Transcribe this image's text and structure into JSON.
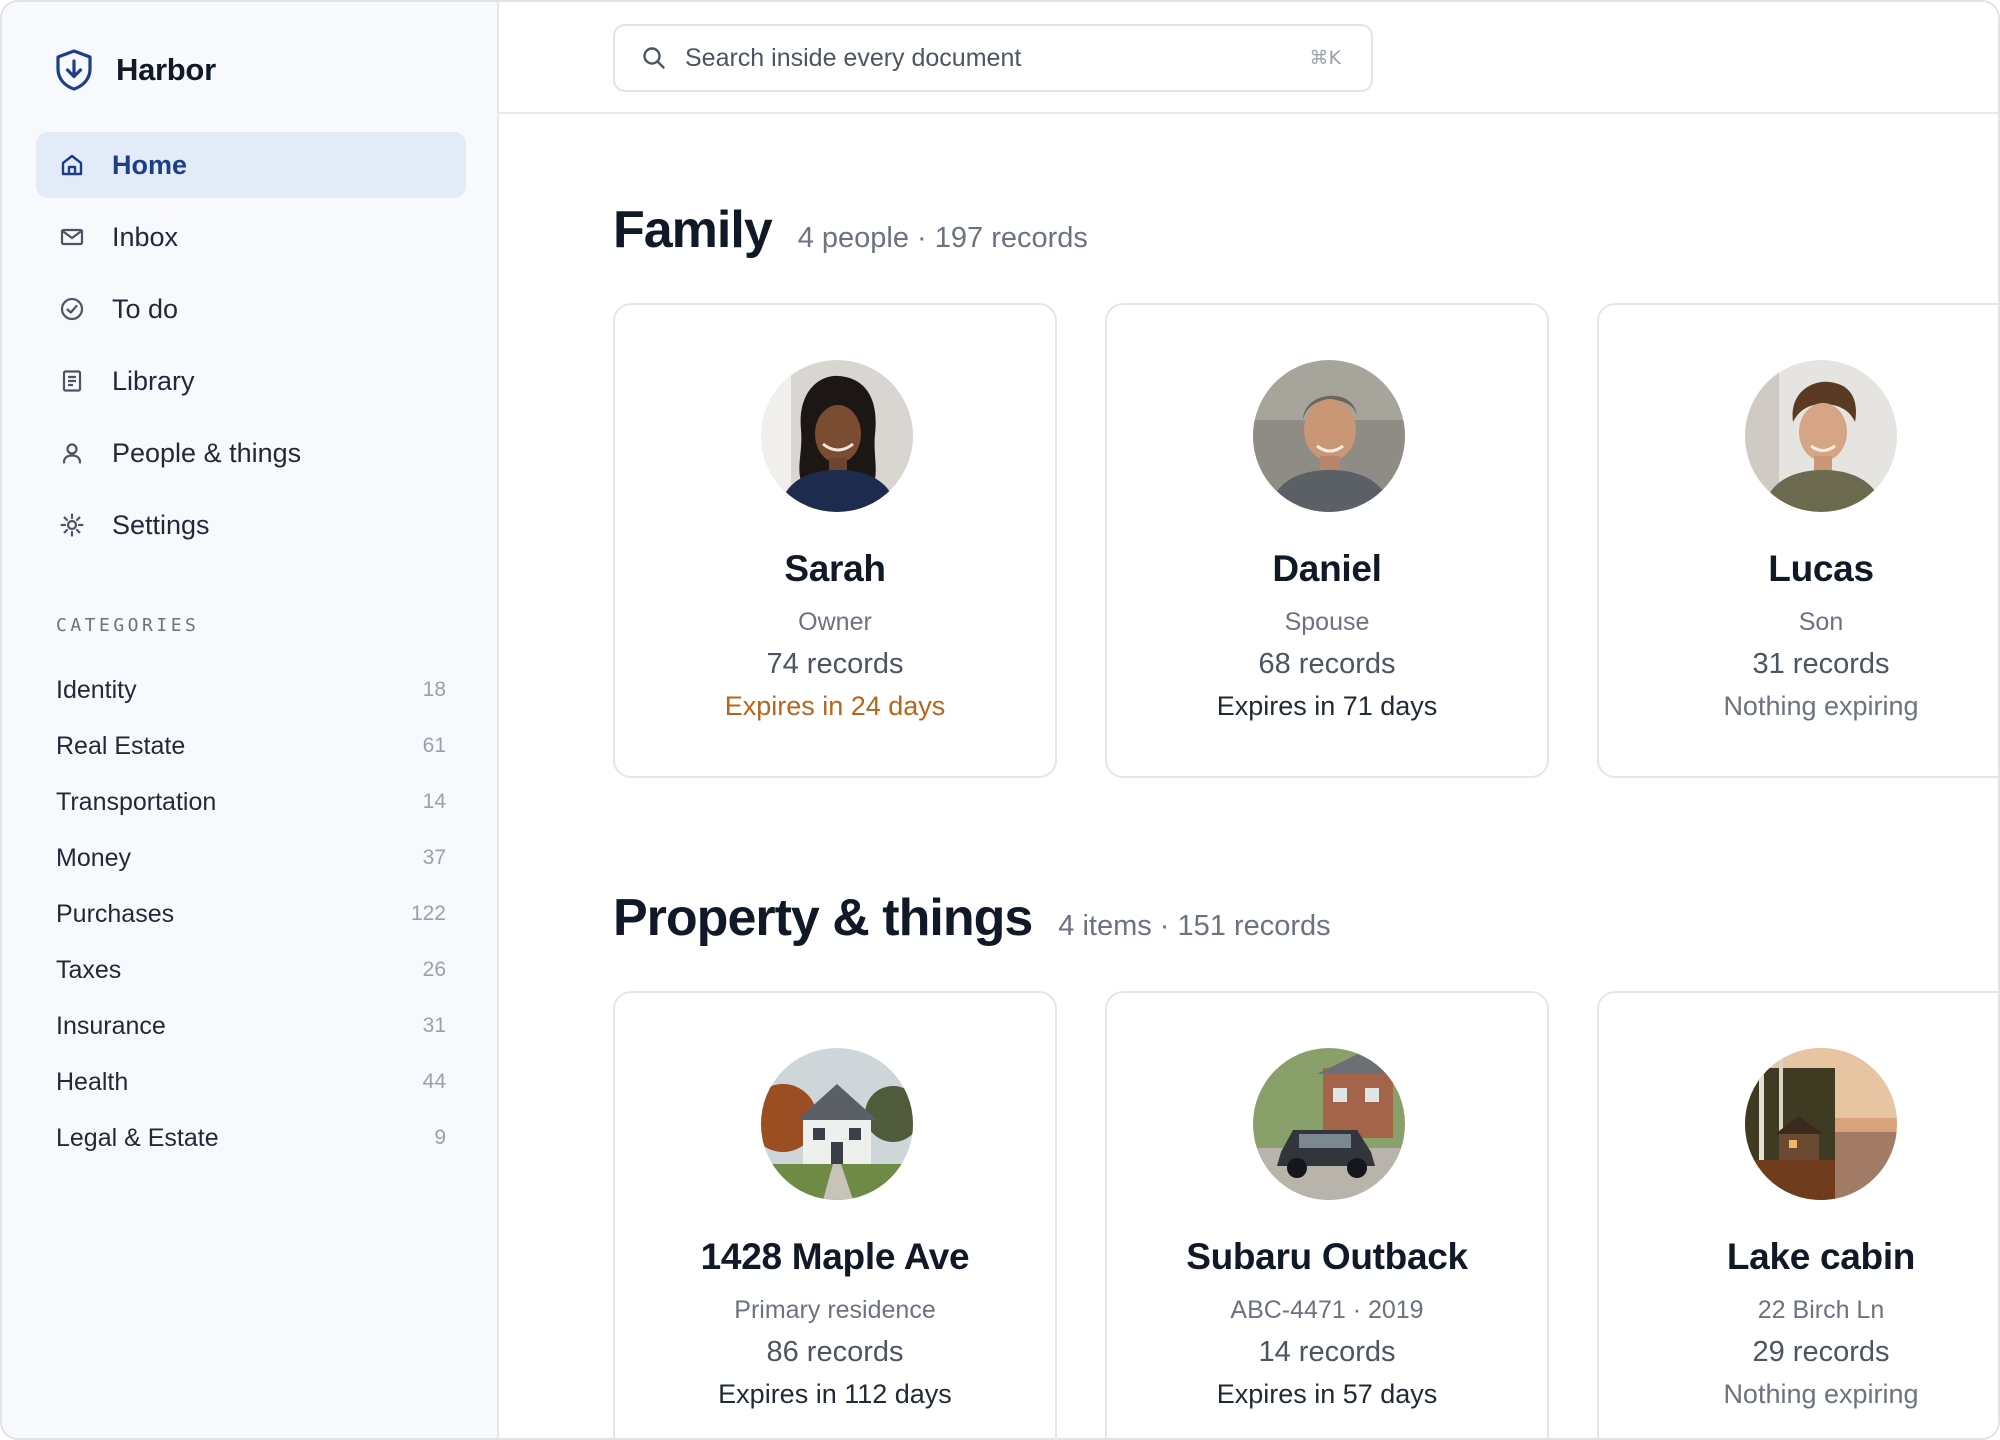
{
  "app": {
    "name": "Harbor"
  },
  "nav": [
    {
      "label": "Home",
      "icon": "home-icon",
      "active": true
    },
    {
      "label": "Inbox",
      "icon": "mail-icon"
    },
    {
      "label": "To do",
      "icon": "check-circle-icon"
    },
    {
      "label": "Library",
      "icon": "document-icon"
    },
    {
      "label": "People & things",
      "icon": "user-icon"
    },
    {
      "label": "Settings",
      "icon": "gear-icon"
    }
  ],
  "categories": {
    "heading": "CATEGORIES",
    "items": [
      {
        "label": "Identity",
        "count": "18"
      },
      {
        "label": "Real Estate",
        "count": "61"
      },
      {
        "label": "Transportation",
        "count": "14"
      },
      {
        "label": "Money",
        "count": "37"
      },
      {
        "label": "Purchases",
        "count": "122"
      },
      {
        "label": "Taxes",
        "count": "26"
      },
      {
        "label": "Insurance",
        "count": "31"
      },
      {
        "label": "Health",
        "count": "44"
      },
      {
        "label": "Legal & Estate",
        "count": "9"
      }
    ]
  },
  "search": {
    "placeholder": "Search inside every document",
    "shortcut": "⌘K"
  },
  "family": {
    "title": "Family",
    "meta": "4 people · 197 records",
    "cards": [
      {
        "name": "Sarah",
        "sub": "Owner",
        "records": "74 records",
        "expiry": "Expires in 24 days",
        "expiry_state": "warning"
      },
      {
        "name": "Daniel",
        "sub": "Spouse",
        "records": "68 records",
        "expiry": "Expires in 71 days",
        "expiry_state": "normal"
      },
      {
        "name": "Lucas",
        "sub": "Son",
        "records": "31 records",
        "expiry": "Nothing expiring",
        "expiry_state": "none"
      }
    ]
  },
  "property": {
    "title": "Property & things",
    "meta": "4 items · 151 records",
    "cards": [
      {
        "name": "1428 Maple Ave",
        "sub": "Primary residence",
        "records": "86 records",
        "expiry": "Expires in 112 days",
        "expiry_state": "normal"
      },
      {
        "name": "Subaru Outback",
        "sub": "ABC-4471 · 2019",
        "records": "14 records",
        "expiry": "Expires in 57 days",
        "expiry_state": "normal"
      },
      {
        "name": "Lake cabin",
        "sub": "22 Birch Ln",
        "records": "29 records",
        "expiry": "Nothing expiring",
        "expiry_state": "none"
      }
    ]
  },
  "colors": {
    "accent": "#1d3f86",
    "active_bg": "#e4ebf8",
    "warning": "#b8651b",
    "sidebar_bg": "#f7f9fc"
  }
}
